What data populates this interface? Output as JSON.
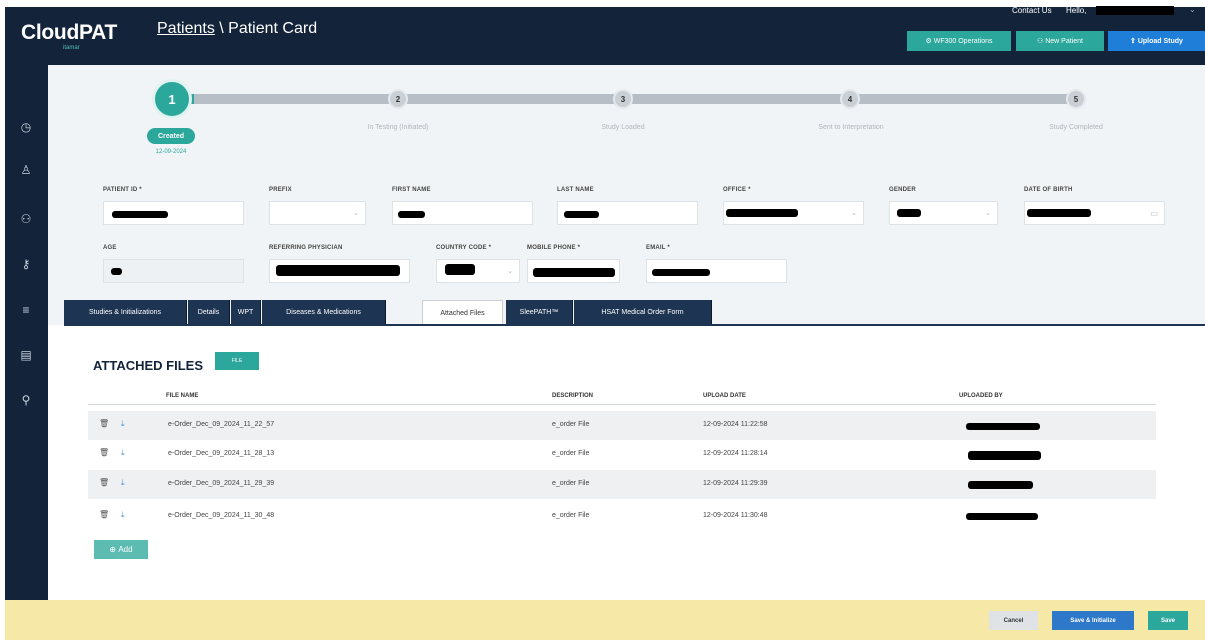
{
  "app": {
    "logo": "CloudPAT",
    "logo_sub": "itamar"
  },
  "breadcrumb": {
    "parent": "Patients",
    "separator": " \\ ",
    "current": "Patient Card"
  },
  "header": {
    "contact": "Contact Us",
    "hello": "Hello,",
    "buttons": {
      "wf": "WF300 Operations",
      "new_patient": "New Patient",
      "upload": "Upload Study"
    }
  },
  "sidebar": {
    "icons": [
      "clock-icon",
      "user-icon",
      "users-icon",
      "key-icon",
      "list-icon",
      "book-icon",
      "search-user-icon"
    ]
  },
  "stepper": {
    "steps": [
      {
        "num": "1",
        "label": "Created",
        "date": "12-09-2024",
        "active": true
      },
      {
        "num": "2",
        "label": "In Testing (Initiated)"
      },
      {
        "num": "3",
        "label": "Study Loaded"
      },
      {
        "num": "4",
        "label": "Sent to Interpretation"
      },
      {
        "num": "5",
        "label": "Study Completed"
      }
    ]
  },
  "form": {
    "patient_id": "PATIENT ID *",
    "prefix": "PREFIX",
    "first_name": "FIRST NAME",
    "last_name": "LAST NAME",
    "office": "OFFICE *",
    "gender": "GENDER",
    "dob": "DATE OF BIRTH",
    "age": "AGE",
    "referring": "REFERRING PHYSICIAN",
    "country_code": "COUNTRY CODE *",
    "mobile": "MOBILE PHONE *",
    "email": "EMAIL *"
  },
  "tabs": [
    {
      "label": "Studies & Initializations"
    },
    {
      "label": "Details"
    },
    {
      "label": "WPT"
    },
    {
      "label": "Diseases & Medications"
    },
    {
      "label": "Attached Files",
      "active": true
    },
    {
      "label": "SleePATH™"
    },
    {
      "label": "HSAT Medical Order Form"
    }
  ],
  "attached": {
    "title": "ATTACHED FILES",
    "filter_label": "FILE",
    "columns": {
      "file_name": "FILE NAME",
      "description": "DESCRIPTION",
      "upload_date": "UPLOAD DATE",
      "uploaded_by": "UPLOADED BY"
    },
    "rows": [
      {
        "file": "e-Order_Dec_09_2024_11_22_57",
        "desc": "e_order File",
        "date": "12-09-2024 11:22:58"
      },
      {
        "file": "e-Order_Dec_09_2024_11_28_13",
        "desc": "e_order File",
        "date": "12-09-2024 11:28:14"
      },
      {
        "file": "e-Order_Dec_09_2024_11_29_39",
        "desc": "e_order File",
        "date": "12-09-2024 11:29:39"
      },
      {
        "file": "e-Order_Dec_09_2024_11_30_48",
        "desc": "e_order File",
        "date": "12-09-2024 11:30:48"
      }
    ],
    "add_label": "Add"
  },
  "actions": {
    "cancel": "Cancel",
    "save_initialize": "Save & Initialize",
    "save": "Save"
  }
}
